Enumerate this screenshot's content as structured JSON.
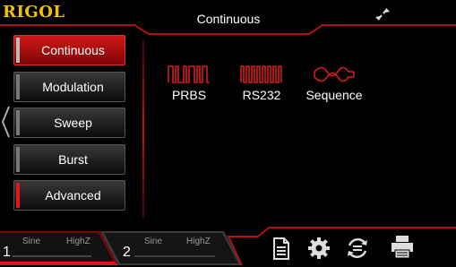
{
  "header": {
    "brand": "RIGOL",
    "title": "Continuous"
  },
  "menu": [
    {
      "label": "Continuous",
      "active": true
    },
    {
      "label": "Modulation"
    },
    {
      "label": "Sweep"
    },
    {
      "label": "Burst"
    },
    {
      "label": "Advanced"
    }
  ],
  "waveforms": [
    {
      "label": "PRBS"
    },
    {
      "label": "RS232"
    },
    {
      "label": "Sequence"
    }
  ],
  "channels": [
    {
      "number": "1",
      "wave": "Sine",
      "impedance": "HighZ"
    },
    {
      "number": "2",
      "wave": "Sine",
      "impedance": "HighZ"
    }
  ],
  "toolbar_icons": [
    "document-icon",
    "gear-icon",
    "utility-icon",
    "print-icon"
  ],
  "colors": {
    "accent": "#d41b1b",
    "brand": "#f2c200"
  }
}
